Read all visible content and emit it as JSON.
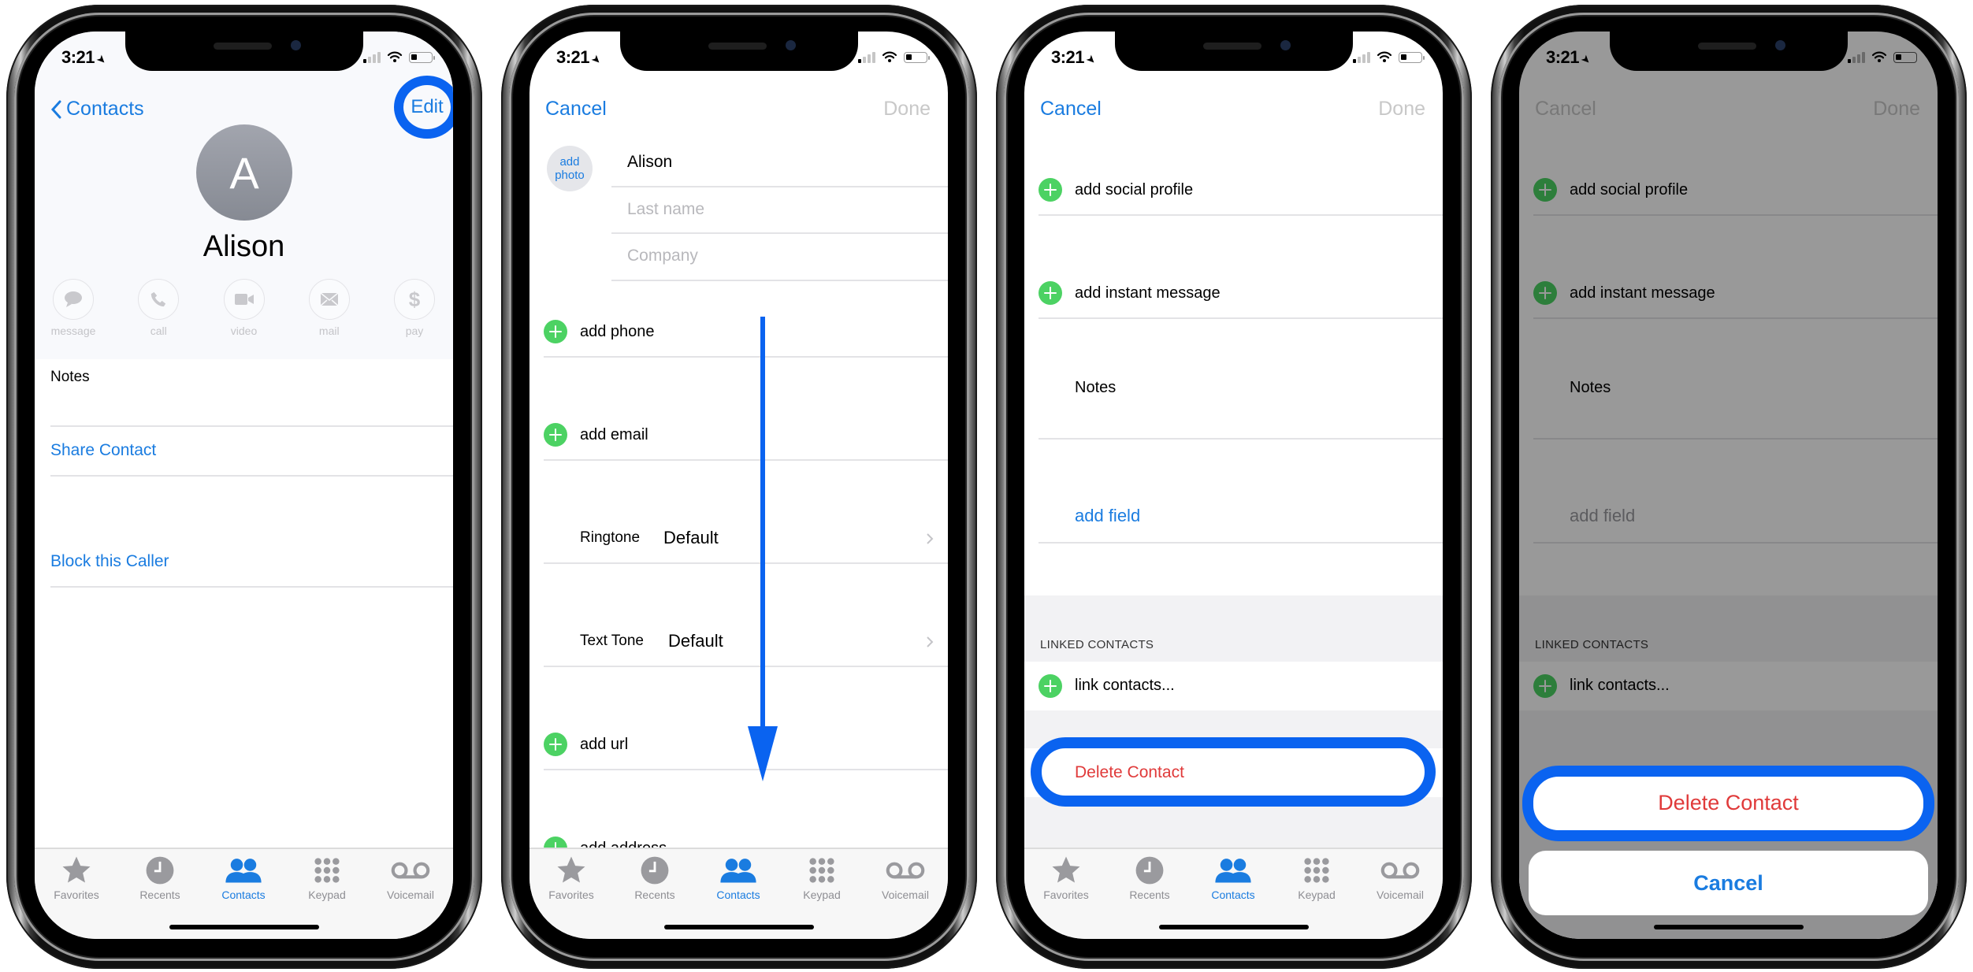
{
  "status_bar": {
    "time": "3:21",
    "location_icon": "location-arrow-icon",
    "signal_icon": "cellular-signal-icon",
    "wifi_icon": "wifi-icon",
    "battery_icon": "battery-low-icon"
  },
  "colors": {
    "accent_blue": "#1a7ce0",
    "annotation_blue": "#0a63f0",
    "add_green": "#4cd263",
    "destructive_red": "#e03a3a",
    "disabled_gray": "#c8c8c8"
  },
  "tab_bar": {
    "items": [
      {
        "label": "Favorites",
        "icon": "star-icon",
        "active": false
      },
      {
        "label": "Recents",
        "icon": "clock-icon",
        "active": false
      },
      {
        "label": "Contacts",
        "icon": "contacts-icon",
        "active": true
      },
      {
        "label": "Keypad",
        "icon": "keypad-icon",
        "active": false
      },
      {
        "label": "Voicemail",
        "icon": "voicemail-icon",
        "active": false
      }
    ]
  },
  "screen1": {
    "back_label": "Contacts",
    "edit_label": "Edit",
    "avatar_initial": "A",
    "contact_name": "Alison",
    "actions": [
      {
        "label": "message",
        "icon": "message-bubble-icon"
      },
      {
        "label": "call",
        "icon": "phone-icon"
      },
      {
        "label": "video",
        "icon": "video-camera-icon"
      },
      {
        "label": "mail",
        "icon": "envelope-icon"
      },
      {
        "label": "pay",
        "icon": "dollar-icon"
      }
    ],
    "notes_label": "Notes",
    "share_contact": "Share Contact",
    "block_caller": "Block this Caller"
  },
  "screen2": {
    "cancel_label": "Cancel",
    "done_label": "Done",
    "add_photo_line1": "add",
    "add_photo_line2": "photo",
    "first_name_value": "Alison",
    "last_name_placeholder": "Last name",
    "company_placeholder": "Company",
    "add_phone": "add phone",
    "add_email": "add email",
    "ringtone_label": "Ringtone",
    "ringtone_value": "Default",
    "text_tone_label": "Text Tone",
    "text_tone_value": "Default",
    "add_url": "add url",
    "add_address": "add address"
  },
  "screen3": {
    "cancel_label": "Cancel",
    "done_label": "Done",
    "add_social_profile": "add social profile",
    "add_instant_message": "add instant message",
    "notes_label": "Notes",
    "add_field": "add field",
    "linked_contacts_header": "LINKED CONTACTS",
    "link_contacts": "link contacts...",
    "delete_contact": "Delete Contact"
  },
  "screen4": {
    "cancel_label": "Cancel",
    "done_label": "Done",
    "add_social_profile": "add social profile",
    "add_instant_message": "add instant message",
    "notes_label": "Notes",
    "add_field": "add field",
    "linked_contacts_header": "LINKED CONTACTS",
    "link_contacts": "link contacts...",
    "sheet_delete": "Delete Contact",
    "sheet_cancel": "Cancel"
  }
}
